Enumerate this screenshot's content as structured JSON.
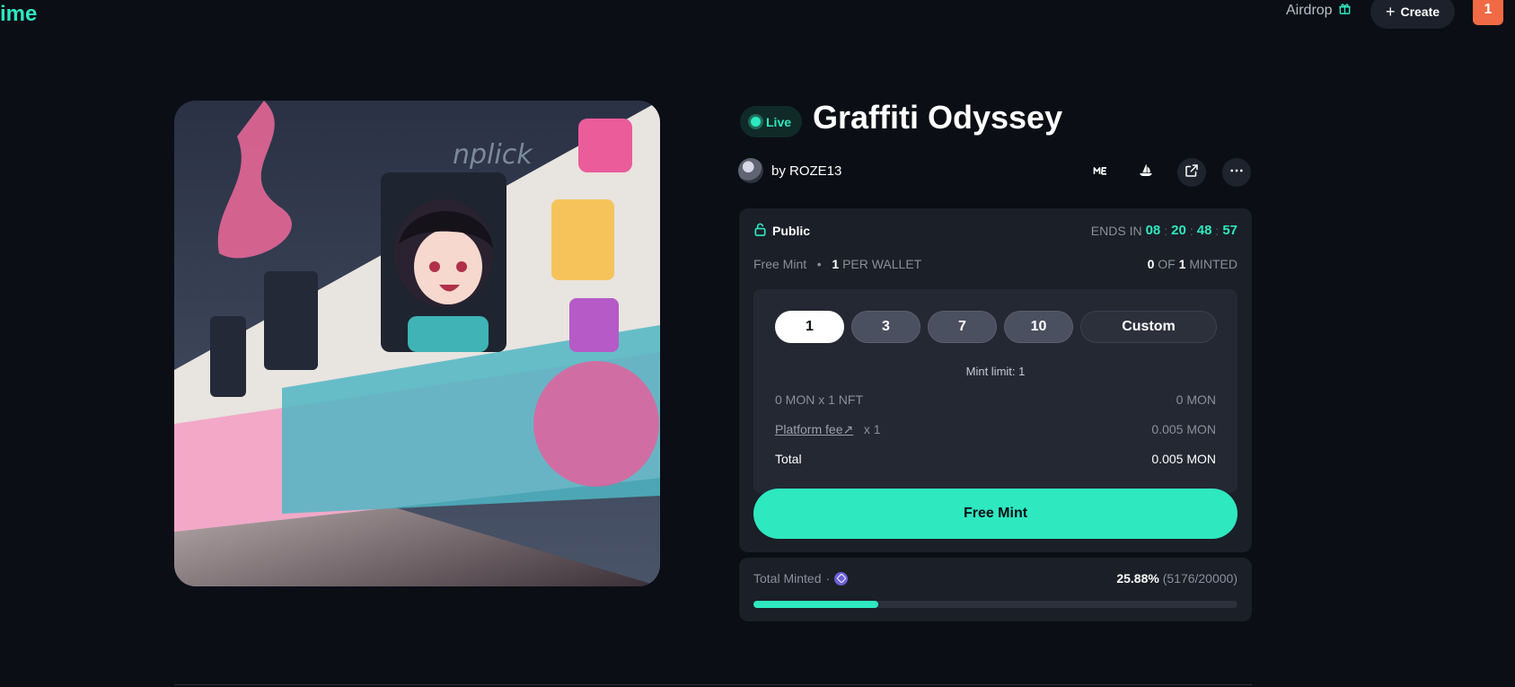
{
  "header": {
    "logo_text": "ime",
    "airdrop_label": "Airdrop",
    "create_label": "Create",
    "notification_count": "1"
  },
  "collection": {
    "status": "Live",
    "title": "Graffiti Odyssey",
    "creator": "by ROZE13",
    "action_icons": [
      "magic-eden-icon",
      "opensea-icon",
      "external-link-icon",
      "more-icon"
    ]
  },
  "mint": {
    "phase": "Public",
    "ends_in_label": "ENDS IN",
    "countdown": {
      "h": "08",
      "m": "20",
      "s": "48",
      "f": "57"
    },
    "mint_type": "Free Mint",
    "per_wallet_count": "1",
    "per_wallet_label": "PER WALLET",
    "minted_user": "0",
    "minted_of": "OF",
    "minted_max": "1",
    "minted_label": "MINTED",
    "quantities": [
      "1",
      "3",
      "7",
      "10"
    ],
    "custom_label": "Custom",
    "selected_quantity": "1",
    "mint_limit": "Mint limit: 1",
    "price_label": "0 MON x 1 NFT",
    "price_value": "0 MON",
    "fee_label": "Platform fee↗",
    "fee_multiplier": "x 1",
    "fee_value": "0.005 MON",
    "total_label": "Total",
    "total_value": "0.005 MON",
    "button_label": "Free Mint"
  },
  "supply": {
    "label": "Total Minted",
    "separator": "·",
    "percent": "25.88%",
    "count": "(5176/20000)",
    "progress": 0.2588
  },
  "colors": {
    "accent": "#2ee8c0",
    "background": "#0b0e15",
    "panel": "#1b1f28",
    "notification": "#f06a45"
  }
}
